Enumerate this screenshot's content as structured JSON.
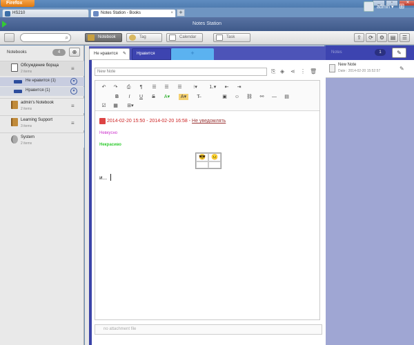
{
  "browser": {
    "app_button": "Firefox",
    "tabs": [
      {
        "label": "HS210"
      },
      {
        "label": "Notes Station - Books"
      }
    ],
    "new_tab": "+"
  },
  "header": {
    "title": "Notes Station",
    "user": "admin",
    "user_caret": "▾"
  },
  "toolbar": {
    "notebook": "Notebook",
    "tag": "Tag",
    "calendar": "Calendar",
    "task": "Task"
  },
  "sidebar": {
    "heading": "Notebooks",
    "count": "4",
    "notebooks": [
      {
        "title": "Обсуждение борща",
        "sub": "2 items"
      },
      {
        "title": "admin's Notebook",
        "sub": "2 items"
      },
      {
        "title": "Learning Support",
        "sub": "3 items"
      },
      {
        "title": "System",
        "sub": "2 items"
      }
    ],
    "sections": [
      {
        "title": "Не нравится",
        "count": "(1)"
      },
      {
        "title": "Нравится",
        "count": "(1)"
      }
    ]
  },
  "editor": {
    "section_tabs": [
      "Не нравится",
      "Нравится",
      "+"
    ],
    "note_title": "New Note",
    "date_start": "2014-02-20 15:50",
    "date_sep": " - ",
    "date_end": "2014-02-20 16:58",
    "reminder_link": "Не уведомлять",
    "line1": "Невкусно",
    "line2": "Некрасиво",
    "emoji_cells": [
      "😎",
      "😐",
      "",
      ""
    ],
    "line3": "и...",
    "attachment_placeholder": "no attachment file"
  },
  "note_list": {
    "heading": "Notes",
    "count": "1",
    "items": [
      {
        "title": "New Note",
        "date": "Date : 2014-02-20 15:52:57"
      }
    ]
  },
  "colors": {
    "accent": "#3d44b0",
    "section_tab_new": "#5bb2f0",
    "right_panel": "#9fa6d3",
    "date_red": "#cc2222"
  }
}
